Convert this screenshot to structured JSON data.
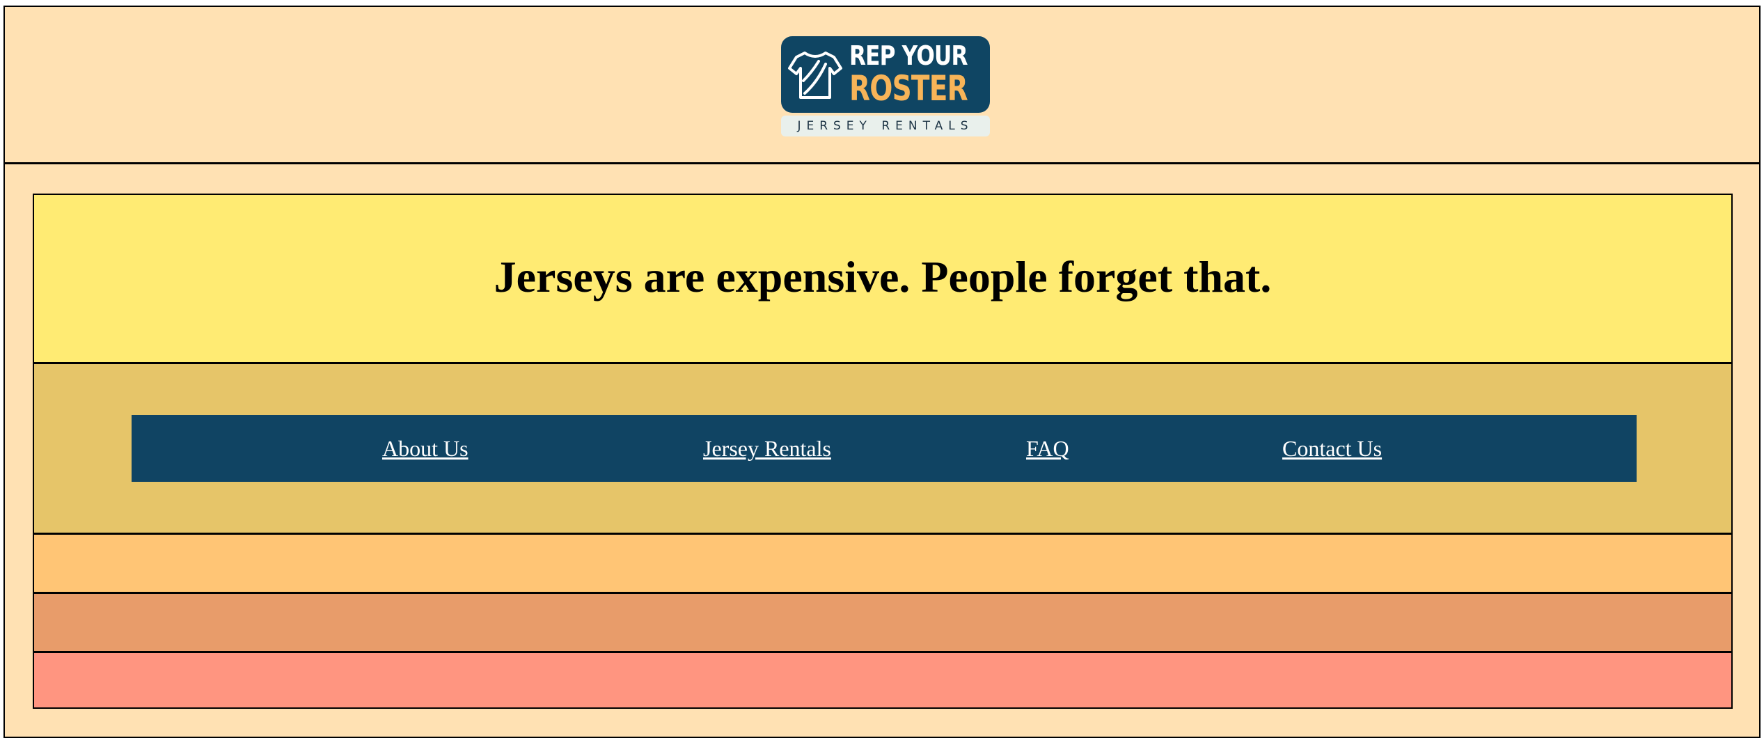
{
  "logo": {
    "line1": "REP YOUR",
    "line2": "ROSTER",
    "tagline": "JERSEY RENTALS",
    "icon": "jersey-icon"
  },
  "hero": {
    "headline": "Jerseys are expensive. People forget that."
  },
  "nav": {
    "items": [
      {
        "label": "About Us"
      },
      {
        "label": "Jersey Rentals"
      },
      {
        "label": "FAQ"
      },
      {
        "label": "Contact Us"
      }
    ]
  },
  "colors": {
    "page_bg": "#ffe1b3",
    "hero_bg": "#ffeb73",
    "nav_band_bg": "#e6c569",
    "nav_bg": "#104463",
    "band1": "#ffc575",
    "band2": "#e89c6a",
    "band3": "#ff9580",
    "logo_navy": "#0f4563",
    "logo_orange": "#f7b458"
  }
}
